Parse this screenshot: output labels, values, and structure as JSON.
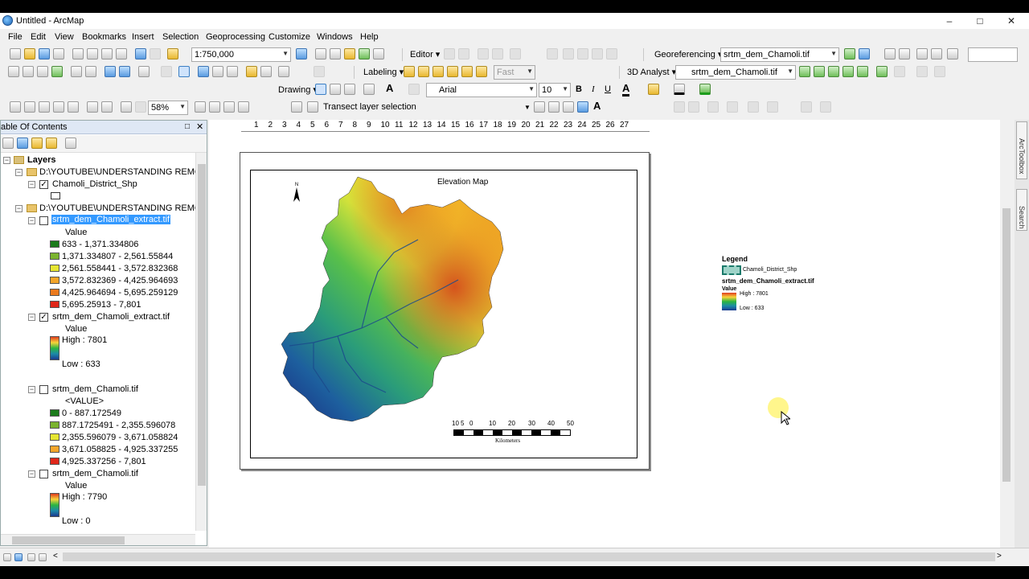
{
  "window": {
    "title": "Untitled - ArcMap",
    "min": "–",
    "max": "□",
    "close": "✕"
  },
  "menu": [
    "File",
    "Edit",
    "View",
    "Bookmarks",
    "Insert",
    "Selection",
    "Geoprocessing",
    "Customize",
    "Windows",
    "Help"
  ],
  "toolbar1": {
    "scale": "1:750,000",
    "editor": "Editor ▾",
    "georeferencing": "Georeferencing ▾",
    "geo_layer": "srtm_dem_Chamoli.tif"
  },
  "toolbar2": {
    "labeling": "Labeling ▾",
    "fast": "Fast",
    "analyst": "3D Analyst ▾",
    "analyst_layer": "srtm_dem_Chamoli.tif"
  },
  "toolbar3": {
    "drawing": "Drawing ▾",
    "font": "Arial",
    "font_size": "10",
    "bold": "B",
    "italic": "I",
    "underline": "U",
    "font_color": "A",
    "text_a": "A"
  },
  "toolbar4": {
    "zoom": "58%",
    "transect": "Transect layer selection"
  },
  "toc": {
    "title": "able Of Contents",
    "layers": "Layers",
    "group1": "D:\\YOUTUBE\\UNDERSTANDING REMOTE SE",
    "shp": "Chamoli_District_Shp",
    "group2": "D:\\YOUTUBE\\UNDERSTANDING REMOTE SE",
    "extract_sel": "srtm_dem_Chamoli_extract.tif",
    "value": "Value",
    "classes1": [
      {
        "label": "633 - 1,371.334806",
        "color": "#1a7a1a"
      },
      {
        "label": "1,371.334807 - 2,561.55844",
        "color": "#7ab32e"
      },
      {
        "label": "2,561.558441 - 3,572.832368",
        "color": "#e6e632"
      },
      {
        "label": "3,572.832369 - 4,425.964693",
        "color": "#f3a52a"
      },
      {
        "label": "4,425.964694 - 5,695.259129",
        "color": "#eb7a1e"
      },
      {
        "label": "5,695.25913 - 7,801",
        "color": "#e0271a"
      }
    ],
    "extract2": "srtm_dem_Chamoli_extract.tif",
    "value2": "Value",
    "high1": "High : 7801",
    "low1": "Low : 633",
    "dem1": "srtm_dem_Chamoli.tif",
    "value_tag": "<VALUE>",
    "classes2": [
      {
        "label": "0 - 887.172549",
        "color": "#1a7a1a"
      },
      {
        "label": "887.1725491 - 2,355.596078",
        "color": "#7ab32e"
      },
      {
        "label": "2,355.596079 - 3,671.058824",
        "color": "#e6e632"
      },
      {
        "label": "3,671.058825 - 4,925.337255",
        "color": "#f3a52a"
      },
      {
        "label": "4,925.337256 - 7,801",
        "color": "#e0271a"
      }
    ],
    "dem2": "srtm_dem_Chamoli.tif",
    "value3": "Value",
    "high2": "High : 7790",
    "low2": "Low : 0"
  },
  "ruler": [
    "1",
    "2",
    "3",
    "4",
    "5",
    "6",
    "7",
    "8",
    "9",
    "10",
    "11",
    "12",
    "13",
    "14",
    "15",
    "16",
    "17",
    "18",
    "19",
    "20",
    "21",
    "22",
    "23",
    "24",
    "25",
    "26",
    "27"
  ],
  "layout": {
    "map_title": "Elevation Map",
    "north": "N",
    "scale_nums": [
      "10",
      "5",
      "0",
      "10",
      "20",
      "30",
      "40",
      "50"
    ],
    "scale_unit": "Kilometers"
  },
  "legend": {
    "title": "Legend",
    "shp": "Chamoli_District_Shp",
    "layer": "srtm_dem_Chamoli_extract.tif",
    "value": "Value",
    "high": "High : 7801",
    "low": "Low : 633"
  },
  "dock": {
    "arctoolbox": "ArcToolbox",
    "search": "Search"
  }
}
